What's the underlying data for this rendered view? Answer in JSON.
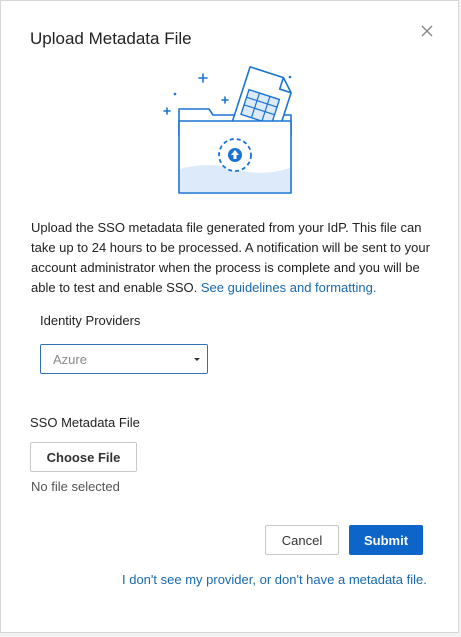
{
  "dialog": {
    "title": "Upload Metadata File",
    "description": "Upload the SSO metadata file generated from your IdP. This file can take up to 24 hours to be processed. A notification will be sent to your account administrator when the process is complete and you will be able to test and enable SSO.",
    "guidelines_link": "See guidelines and formatting."
  },
  "identity_providers": {
    "label": "Identity Providers",
    "selected": "Azure"
  },
  "sso_file": {
    "label": "SSO Metadata File",
    "choose_button": "Choose File",
    "status": "No file selected"
  },
  "actions": {
    "cancel": "Cancel",
    "submit": "Submit"
  },
  "footer": {
    "link": "I don't see my provider, or don't have a metadata file."
  },
  "colors": {
    "accent": "#0d64c9",
    "link": "#1769b0",
    "illustration": "#1a74d4"
  },
  "icons": [
    "close-icon",
    "folder-upload-illustration",
    "chevron-down-icon"
  ]
}
